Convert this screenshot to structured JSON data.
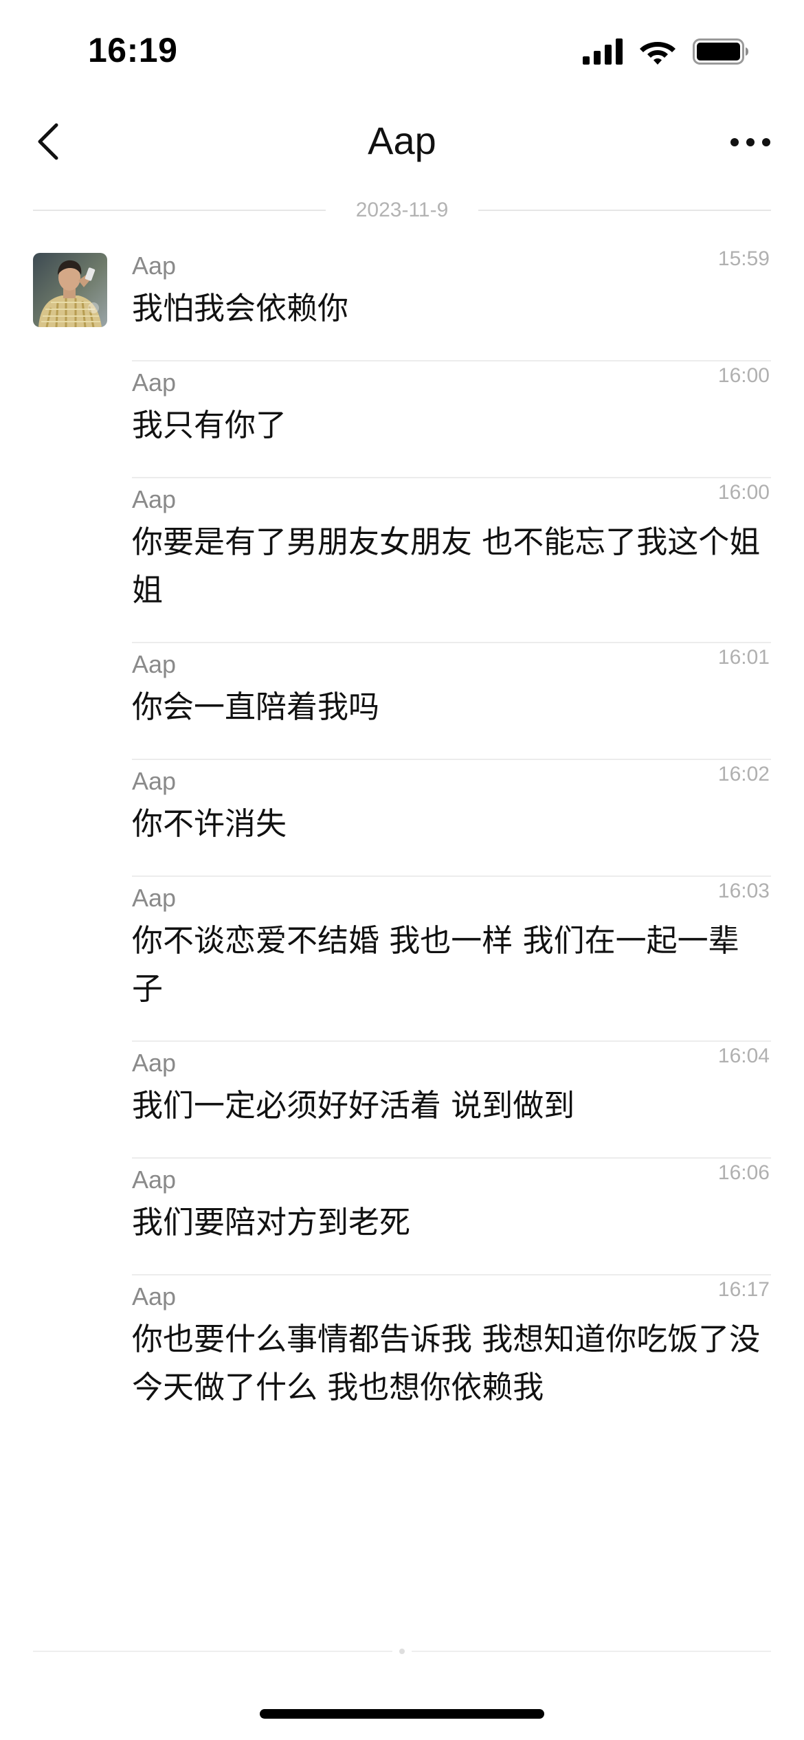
{
  "status_bar": {
    "time": "16:19",
    "icons": [
      "cellular-signal-icon",
      "wifi-icon",
      "battery-icon"
    ]
  },
  "nav": {
    "title": "Aap",
    "back_icon": "chevron-left-icon",
    "more_icon": "more-dots-icon"
  },
  "date_divider": "2023-11-9",
  "messages": [
    {
      "sender": "Aap",
      "time": "15:59",
      "text": "我怕我会依赖你"
    },
    {
      "sender": "Aap",
      "time": "16:00",
      "text": "我只有你了"
    },
    {
      "sender": "Aap",
      "time": "16:00",
      "text": "你要是有了男朋友女朋友 也不能忘了我这个姐姐"
    },
    {
      "sender": "Aap",
      "time": "16:01",
      "text": "你会一直陪着我吗"
    },
    {
      "sender": "Aap",
      "time": "16:02",
      "text": "你不许消失"
    },
    {
      "sender": "Aap",
      "time": "16:03",
      "text": "你不谈恋爱不结婚 我也一样 我们在一起一辈子"
    },
    {
      "sender": "Aap",
      "time": "16:04",
      "text": "我们一定必须好好活着 说到做到"
    },
    {
      "sender": "Aap",
      "time": "16:06",
      "text": "我们要陪对方到老死"
    },
    {
      "sender": "Aap",
      "time": "16:17",
      "text": "你也要什么事情都告诉我 我想知道你吃饭了没 今天做了什么 我也想你依赖我"
    }
  ]
}
